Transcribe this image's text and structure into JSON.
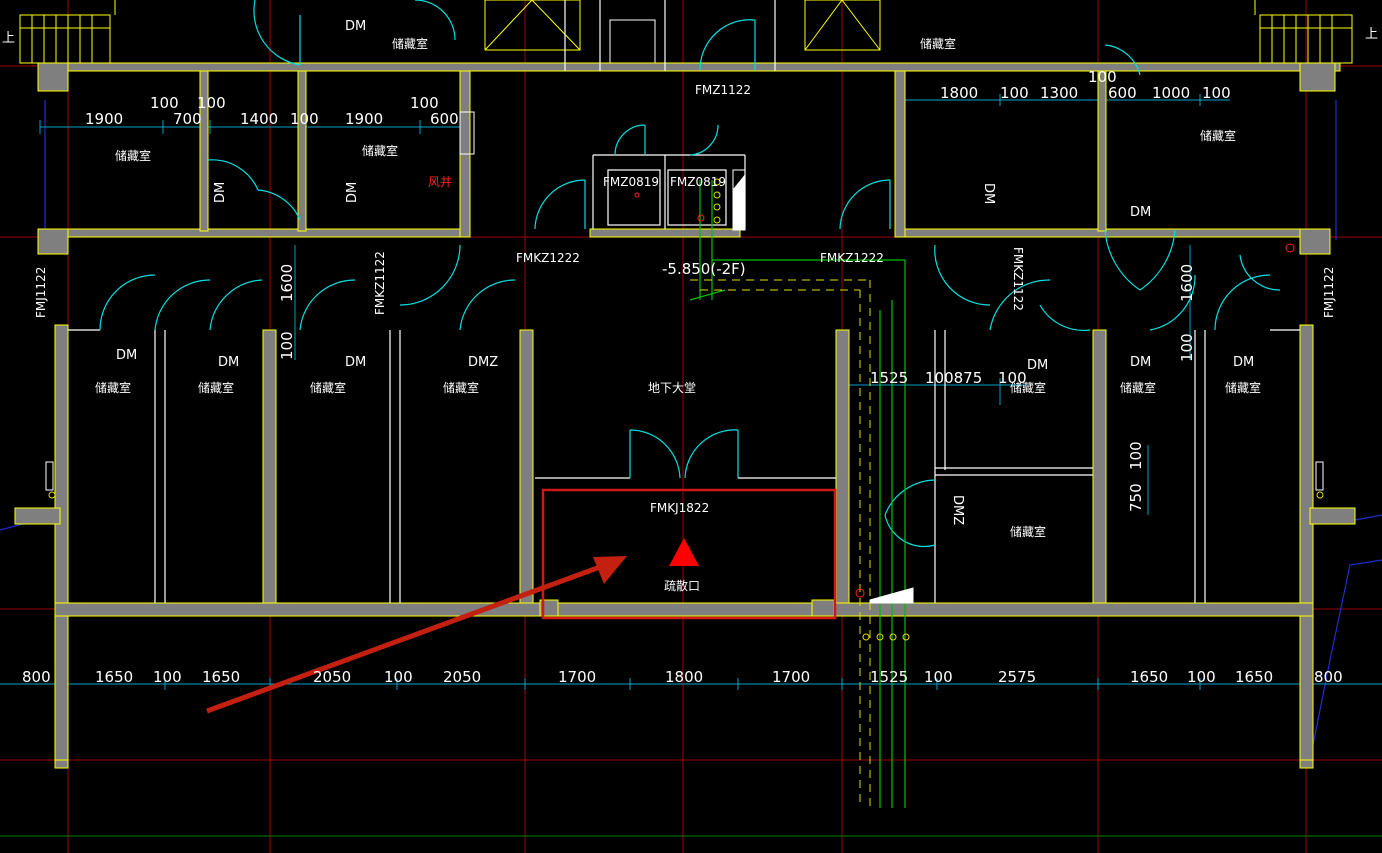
{
  "colors": {
    "background": "#000000",
    "wall": "#7f7f7f",
    "wall_edge": "#ffff00",
    "grid_red": "#a00000",
    "grid_blue": "#1a2fd0",
    "dimension_line": "#00a0c8",
    "door_swing": "#00e0e0",
    "pipe_green": "#00c000",
    "highlight_box": "#d01818",
    "arrow": "#c42010",
    "marker": "#ff0000"
  },
  "rooms": {
    "storage": "储藏室",
    "hall": "地下大堂",
    "exit": "疏散口"
  },
  "room_tags": {
    "dm": "DM",
    "dmz": "DMZ"
  },
  "doors": {
    "fmz1122": "FMZ1122",
    "fmkz1222_left": "FMKZ1222",
    "fmkz1222_right": "FMKZ1222",
    "fmz0819_a": "FMZ0819",
    "fmz0819_b": "FMZ0819",
    "fmj1122_left": "FMJ1122",
    "fmj1122_right": "FMJ1122",
    "fmkz1122_left": "FMKZ1122",
    "fmkz1122_right": "FMKZ1122",
    "fmkj1822": "FMKJ1822"
  },
  "labels": {
    "level": "-5.850(-2F)",
    "shaft": "风井",
    "edge_left": "上",
    "edge_right": "上"
  },
  "dimensions": {
    "top_left": [
      "1900",
      "100",
      "700",
      "100",
      "1400",
      "100",
      "1900",
      "100",
      "600"
    ],
    "top_right": [
      "1800",
      "100",
      "1300",
      "100",
      "600",
      "1000",
      "100"
    ],
    "bottom": [
      "800",
      "1650",
      "100",
      "1650",
      "2050",
      "100",
      "2050",
      "1700",
      "1800",
      "1700",
      "1525",
      "100",
      "2575",
      "1650",
      "100",
      "1650",
      "800"
    ],
    "vertical": [
      "1600",
      "100",
      "1600",
      "100",
      "750",
      "100"
    ],
    "mid_right": [
      "1525",
      "100875",
      "100"
    ]
  }
}
